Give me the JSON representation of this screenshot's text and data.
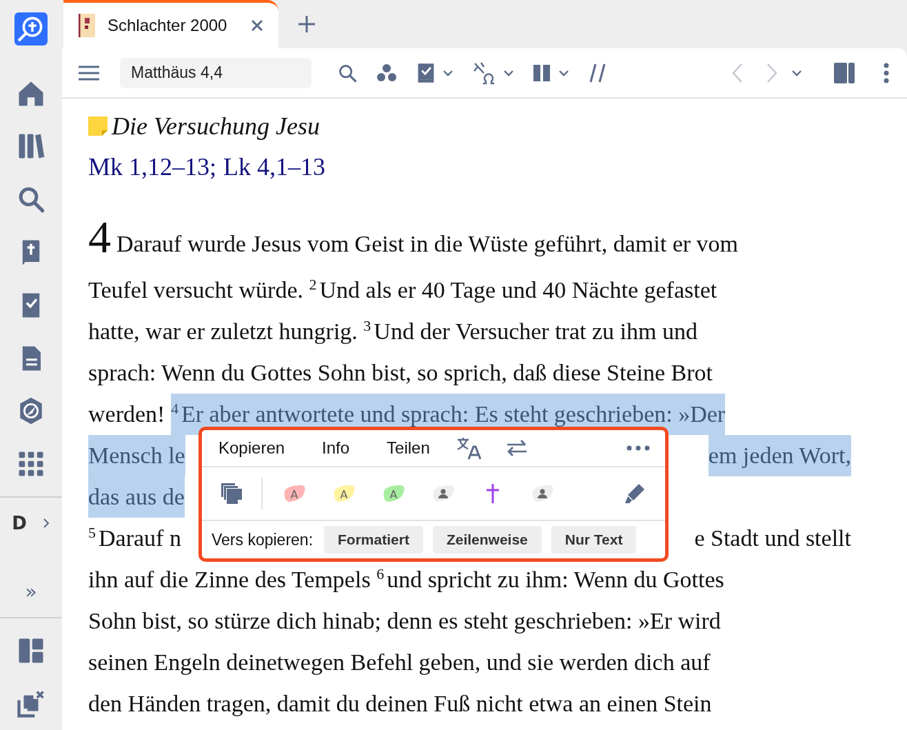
{
  "sidebar": {
    "profile_letter": "D",
    "expand_glyph": "»"
  },
  "tabs": [
    {
      "title": "Schlachter 2000",
      "selected": true
    }
  ],
  "toolbar": {
    "reference": "Matthäus 4,4",
    "back_disabled": true,
    "forward_disabled": true
  },
  "passage": {
    "heading": "Die Versuchung Jesu",
    "cross_references": [
      "Mk 1,12–13",
      "Lk 4,1–13"
    ],
    "reference_separator": ";",
    "drop_cap": "4",
    "lines": [
      {
        "left": [
          {
            "text": "Darauf wurde Jesus vom Geist in die Wüste geführt, damit er vom",
            "selected": false
          }
        ]
      },
      {
        "left": [
          {
            "text": "Teufel versucht würde. ",
            "selected": false
          },
          {
            "verse": "2",
            "text": "Und als er 40 Tage und 40 Nächte gefastet",
            "selected": false
          }
        ]
      },
      {
        "left": [
          {
            "text": "hatte, war er zuletzt hungrig. ",
            "selected": false
          },
          {
            "verse": "3",
            "text": "Und der Versucher trat zu ihm und",
            "selected": false
          }
        ]
      },
      {
        "left": [
          {
            "text": "sprach: Wenn du Gottes Sohn bist, so sprich, daß diese Steine Brot",
            "selected": false
          }
        ]
      },
      {
        "left": [
          {
            "text": "werden! ",
            "selected": false
          },
          {
            "verse": "4",
            "text": "Er aber antwortete und sprach: Es steht geschrieben: »Der",
            "selected": true
          }
        ]
      },
      {
        "left": [
          {
            "text": "Mensch le",
            "selected": true
          }
        ],
        "right": [
          {
            "text": "em jeden Wort,",
            "selected": true
          }
        ]
      },
      {
        "left": [
          {
            "text": "das aus de",
            "selected": true
          }
        ]
      },
      {
        "left": [
          {
            "verse": "5",
            "text": "Darauf n",
            "selected": false
          }
        ],
        "right": [
          {
            "text": "e Stadt und stellt",
            "selected": false
          }
        ]
      },
      {
        "left": [
          {
            "text": "ihn auf die Zinne des Tempels ",
            "selected": false
          },
          {
            "verse": "6",
            "text": "und spricht zu ihm: Wenn du Gottes",
            "selected": false
          }
        ]
      },
      {
        "left": [
          {
            "text": "Sohn bist, so stürze dich hinab; denn es steht geschrieben: »Er wird",
            "selected": false
          }
        ]
      },
      {
        "left": [
          {
            "text": "seinen Engeln deinetwegen Befehl geben, und sie werden dich auf",
            "selected": false
          }
        ]
      },
      {
        "left": [
          {
            "text": "den Händen tragen, damit du deinen Fuß nicht etwa an einen Stein",
            "selected": false
          }
        ]
      }
    ]
  },
  "popup": {
    "actions": [
      "Kopieren",
      "Info",
      "Teilen"
    ],
    "highlights": [
      {
        "kind": "letter",
        "label": "A",
        "color": "#ffb4b4"
      },
      {
        "kind": "letter",
        "label": "A",
        "color": "#fff3a0"
      },
      {
        "kind": "letter",
        "label": "A",
        "color": "#a8eea0"
      },
      {
        "kind": "person",
        "color": "#eeeeee"
      },
      {
        "kind": "cross",
        "color": "#a040f0"
      },
      {
        "kind": "person",
        "color": "#eeeeee"
      }
    ],
    "copy_label": "Vers kopieren:",
    "copy_buttons": [
      "Formatiert",
      "Zeilenweise",
      "Nur Text"
    ]
  }
}
